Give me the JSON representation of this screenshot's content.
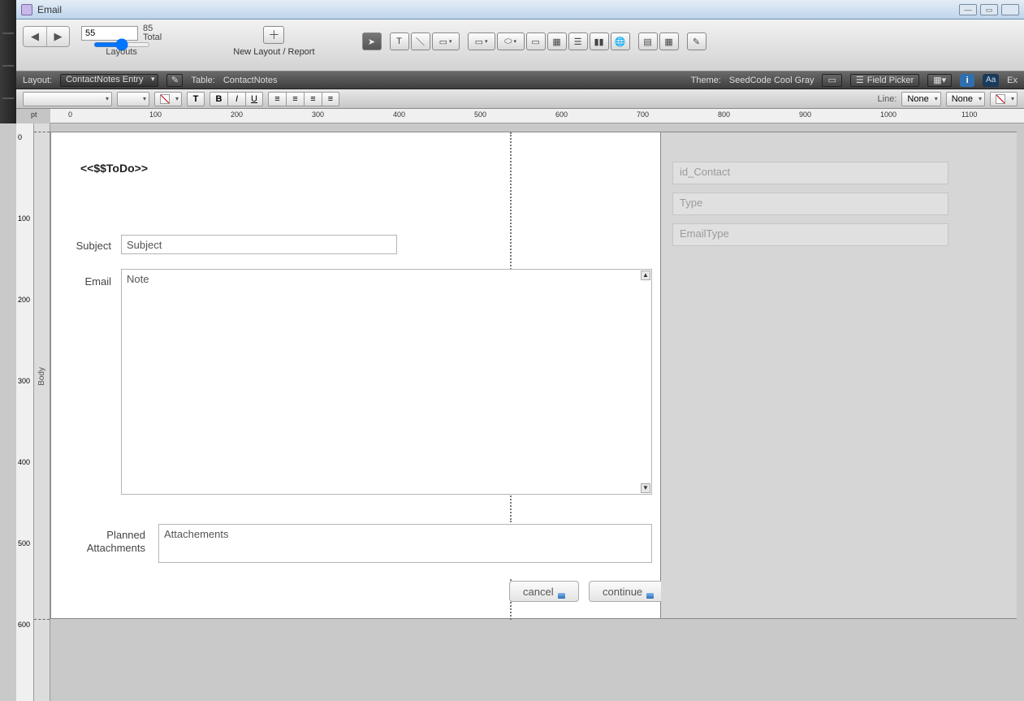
{
  "window": {
    "title": "Email"
  },
  "toolbar": {
    "layout_number": "55",
    "total_count": "85",
    "total_label": "Total",
    "layouts_label": "Layouts",
    "new_layout_label": "New Layout / Report"
  },
  "layoutbar": {
    "layout_label": "Layout:",
    "layout_value": "ContactNotes Entry",
    "table_label": "Table:",
    "table_value": "ContactNotes",
    "theme_label": "Theme:",
    "theme_value": "SeedCode Cool Gray",
    "field_picker": "Field Picker",
    "exit": "Ex"
  },
  "fmtbar": {
    "line_label": "Line:",
    "line_value": "None",
    "fill_value": "None"
  },
  "ruler": {
    "unit": "pt"
  },
  "gutter": {
    "body_label": "Body"
  },
  "page": {
    "heading": "<<$$ToDo>>",
    "subject_label": "Subject",
    "subject_value": "Subject",
    "email_label": "Email",
    "email_value": "Note",
    "attach_label1": "Planned",
    "attach_label2": "Attachments",
    "attach_value": "Attachements",
    "cancel": "cancel",
    "continue": "continue"
  },
  "side": {
    "id_contact": "id_Contact",
    "type": "Type",
    "email_type": "EmailType"
  }
}
